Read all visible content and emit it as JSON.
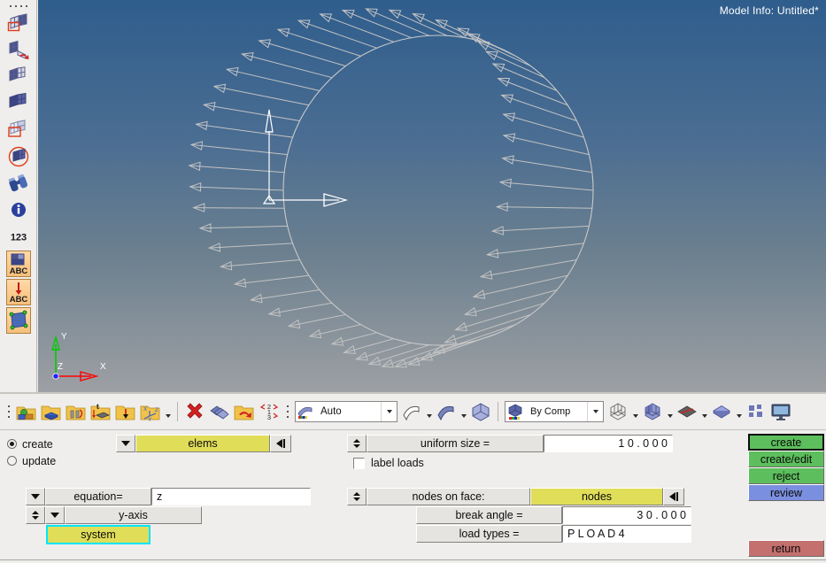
{
  "app": {
    "model_info": "Model Info: Untitled*"
  },
  "viewport": {
    "background_top": "#2f5d8c",
    "background_bottom": "#9da0a4",
    "entity_color": "#c3c3c3",
    "triad": {
      "x_label": "X",
      "y_label": "Y",
      "z_label": "Z",
      "x_color": "#ff0000",
      "y_color": "#00cc00",
      "z_color": "#2222ff"
    },
    "model_description": "spherical shell mesh with outward pressure load vectors"
  },
  "left_toolbar": {
    "items": [
      {
        "name": "elems-create-icon",
        "tooltip": "Create elements"
      },
      {
        "name": "elems-edit-icon",
        "tooltip": "Edit elements"
      },
      {
        "name": "elems-display-icon",
        "tooltip": "Element display"
      },
      {
        "name": "elems-solid-icon",
        "tooltip": "Solid mesh"
      },
      {
        "name": "elems-select-icon",
        "tooltip": "Select elements"
      },
      {
        "name": "elems-circle-icon",
        "tooltip": "Masking"
      },
      {
        "name": "binoculars-icon",
        "tooltip": "Find"
      },
      {
        "name": "info-icon",
        "tooltip": "Entity info"
      },
      {
        "name": "numbers-icon",
        "tooltip": "Numbers"
      },
      {
        "name": "abc-grid-icon",
        "tooltip": "Named entities"
      },
      {
        "name": "abc-load-icon",
        "tooltip": "Load labels"
      },
      {
        "name": "surface-icon",
        "tooltip": "Surfaces"
      }
    ]
  },
  "toolbar_strip": {
    "group1": [
      {
        "name": "collectors-icon",
        "tooltip": "Collectors"
      },
      {
        "name": "component-icon",
        "tooltip": "Component"
      },
      {
        "name": "property-icon",
        "tooltip": "Property"
      },
      {
        "name": "material-icon",
        "tooltip": "Material"
      },
      {
        "name": "load-collector-icon",
        "tooltip": "Load collector"
      },
      {
        "name": "system-collector-icon",
        "tooltip": "System collector"
      }
    ],
    "group2": [
      {
        "name": "delete-icon",
        "tooltip": "Delete"
      },
      {
        "name": "organize-icon",
        "tooltip": "Organize"
      },
      {
        "name": "renumber-icon",
        "tooltip": "Renumber folders"
      },
      {
        "name": "reorder-icon",
        "tooltip": "Reorder"
      }
    ],
    "visual_mode": {
      "label": "Auto",
      "name": "visualization-mode-combo"
    },
    "group3": [
      {
        "name": "shaded-geom-icon",
        "tooltip": "Shaded geometry"
      },
      {
        "name": "shaded-surface-icon",
        "tooltip": "Shaded surfaces"
      },
      {
        "name": "shaded-solid-icon",
        "tooltip": "Shaded solid"
      }
    ],
    "color_mode": {
      "label": "By Comp",
      "name": "color-mode-combo"
    },
    "group4": [
      {
        "name": "wireframe-cube-icon",
        "tooltip": "Wireframe elements"
      },
      {
        "name": "shaded-cube-icon",
        "tooltip": "Shaded elements"
      },
      {
        "name": "mesh-lines-icon",
        "tooltip": "Mesh lines"
      },
      {
        "name": "shaded-plate-icon",
        "tooltip": "Shaded plate"
      },
      {
        "name": "tiles-icon",
        "tooltip": "Window layout"
      },
      {
        "name": "monitor-icon",
        "tooltip": "Graphics settings"
      }
    ]
  },
  "panel": {
    "mode_radios": [
      {
        "label": "create",
        "selected": true,
        "name": "radio-create"
      },
      {
        "label": "update",
        "selected": false,
        "name": "radio-update"
      }
    ],
    "entity_selector": {
      "label": "elems",
      "name": "elems-selector"
    },
    "equation": {
      "label": "equation=",
      "value": "z",
      "name": "equation-field"
    },
    "axis": {
      "label": "y-axis",
      "name": "axis-selector"
    },
    "system": {
      "label": "system",
      "name": "system-selector"
    },
    "magnitude": {
      "label": "uniform size =",
      "value": "1 0 . 0 0 0",
      "name": "uniform-size-field"
    },
    "label_loads": {
      "label": "label loads",
      "checked": false,
      "name": "label-loads-checkbox"
    },
    "nodes_on_face": {
      "label": "nodes on face:",
      "selector_label": "nodes",
      "name": "nodes-on-face-selector"
    },
    "break_angle": {
      "label": "break angle =",
      "value": "3 0 . 0 0 0",
      "name": "break-angle-field"
    },
    "load_types": {
      "label": "load types =",
      "value": "P L O A D 4",
      "name": "load-types-field"
    },
    "actions": [
      {
        "label": "create",
        "style": "green",
        "selected": true,
        "name": "create-button"
      },
      {
        "label": "create/edit",
        "style": "green",
        "selected": false,
        "name": "create-edit-button"
      },
      {
        "label": "reject",
        "style": "green",
        "selected": false,
        "name": "reject-button"
      },
      {
        "label": "review",
        "style": "blue",
        "selected": false,
        "name": "review-button"
      }
    ],
    "return_action": {
      "label": "return",
      "style": "red",
      "name": "return-button"
    }
  },
  "colors": {
    "yellow_selector": "#e0dd59",
    "highlight_cyan": "#00e5ff",
    "green_button": "#5cbe5c",
    "blue_button": "#7b8fe0",
    "red_button": "#c4706e",
    "panel_bg": "#efeeec"
  }
}
